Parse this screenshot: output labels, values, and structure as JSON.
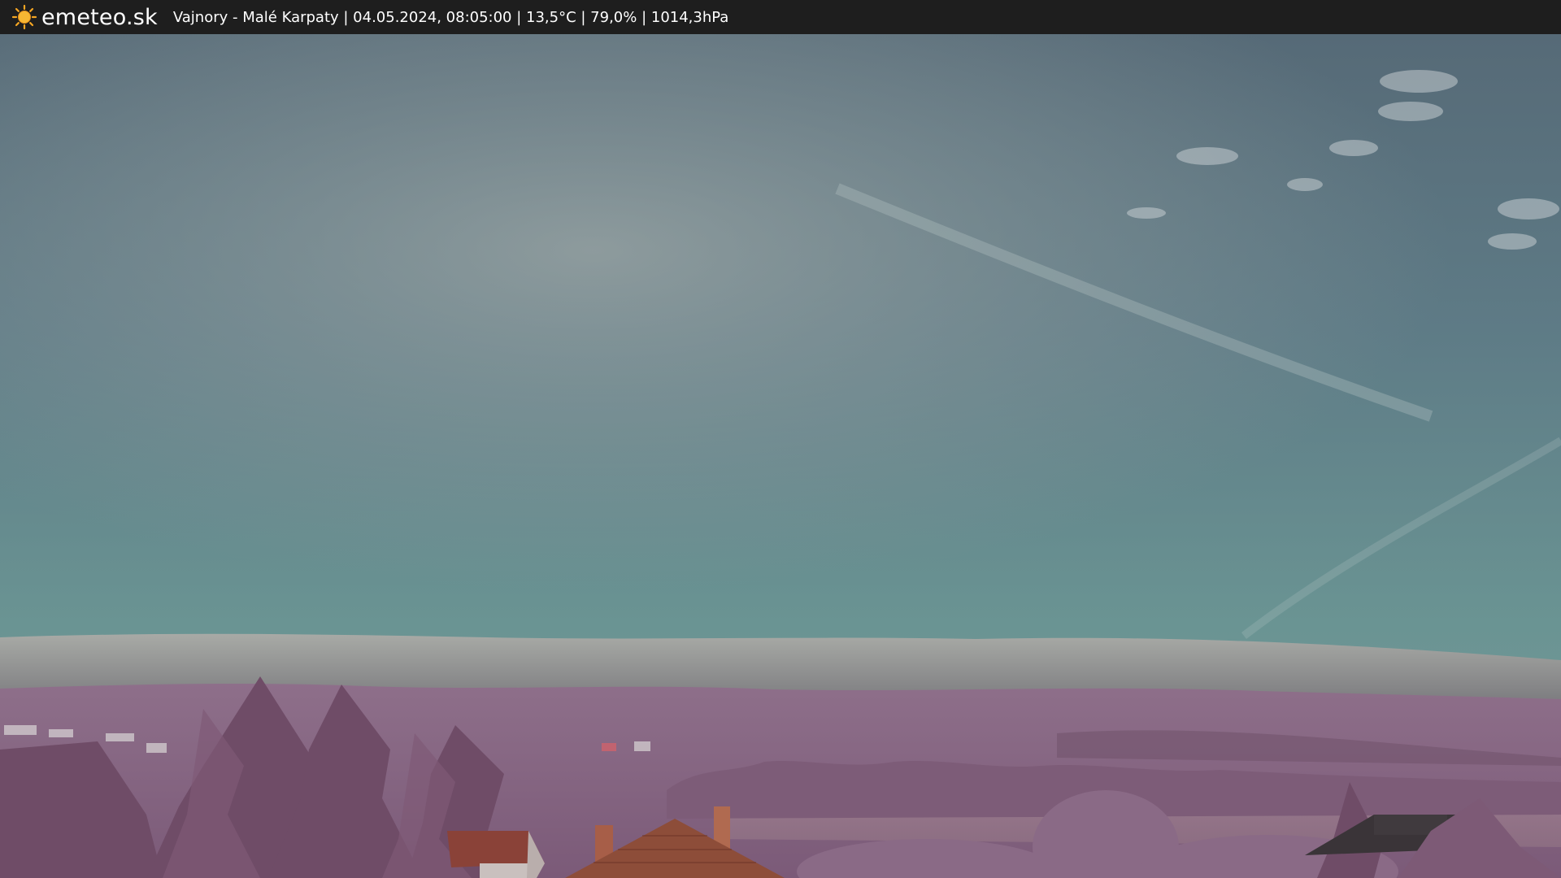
{
  "header": {
    "logo_text": "emeteo.sk",
    "logo_icon": "sun-icon",
    "caption": "Vajnory - Malé Karpaty | 04.05.2024, 08:05:00 | 13,5°C | 79,0% | 1014,3hPa"
  },
  "colors": {
    "bar_background": "#1e1e1e",
    "sun": "#f5a623",
    "sky_top": "#5d6f79",
    "sky_bottom": "#6a9295",
    "hills": "#8a6a86",
    "roof": "#8a4a38"
  }
}
